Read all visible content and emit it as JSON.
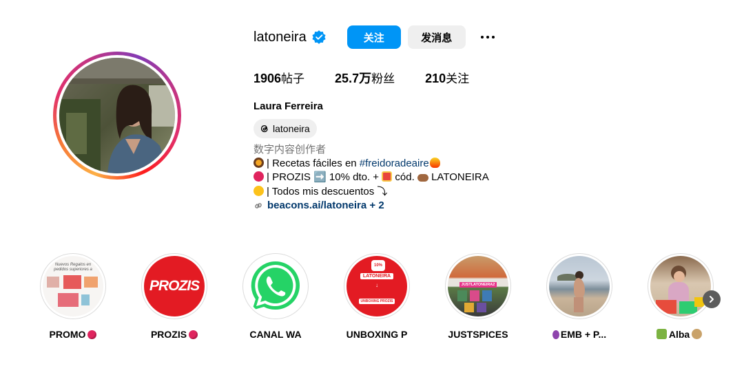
{
  "profile": {
    "username": "latoneira",
    "follow_label": "关注",
    "message_label": "发消息",
    "full_name": "Laura Ferreira",
    "threads_handle": "latoneira"
  },
  "stats": {
    "posts_value": "1906",
    "posts_label": "帖子",
    "followers_value": "25.7万",
    "followers_label": "粉丝",
    "following_value": "210",
    "following_label": "关注"
  },
  "bio": {
    "category": "数字内容创作者",
    "line1_text": "| Recetas fáciles en ",
    "line1_hashtag": "#freidoradeaire",
    "line2_text": "| PROZIS ➡️ 10% dto. + ",
    "line2_text_b": " cód. ",
    "line2_text_c": " LATONEIRA",
    "line3_text": "| Todos mis descuentos ⤵",
    "link": "beacons.ai/latoneira + 2"
  },
  "highlights": [
    {
      "label": "PROMO",
      "mini_text": "Nuevos Regalos en pedidos superiores a"
    },
    {
      "label": "PROZIS",
      "cover_text": "PROZIS"
    },
    {
      "label": "CANAL WA"
    },
    {
      "label": "UNBOXING P",
      "cover_title": "LATONEIRA",
      "cover_badge": "10%",
      "cover_sub": "UNBOXING PROZIS"
    },
    {
      "label": "JUSTSPICES",
      "cover_code": "JUSTLATONEIRA2"
    },
    {
      "label": "EMB + P..."
    },
    {
      "label": "Alba"
    }
  ],
  "colors": {
    "accent": "#0095f6",
    "link": "#00376b",
    "secondary_text": "#737373",
    "button_gray": "#efefef"
  }
}
